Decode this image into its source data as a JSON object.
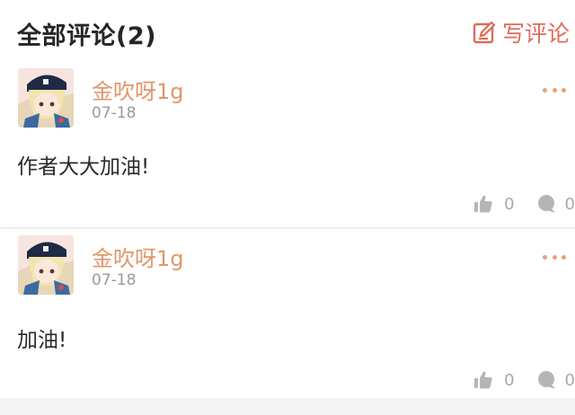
{
  "header": {
    "title": "全部评论(2)",
    "write_label": "写评论"
  },
  "colors": {
    "accent": "#e16a5a",
    "username": "#e0976a",
    "muted": "#9a9a9a"
  },
  "comments": [
    {
      "username": "金吹呀1g",
      "date": "07-18",
      "text": "作者大大加油!",
      "likes": "0",
      "replies": "0"
    },
    {
      "username": "金吹呀1g",
      "date": "07-18",
      "text": "加油!",
      "likes": "0",
      "replies": "0"
    }
  ]
}
